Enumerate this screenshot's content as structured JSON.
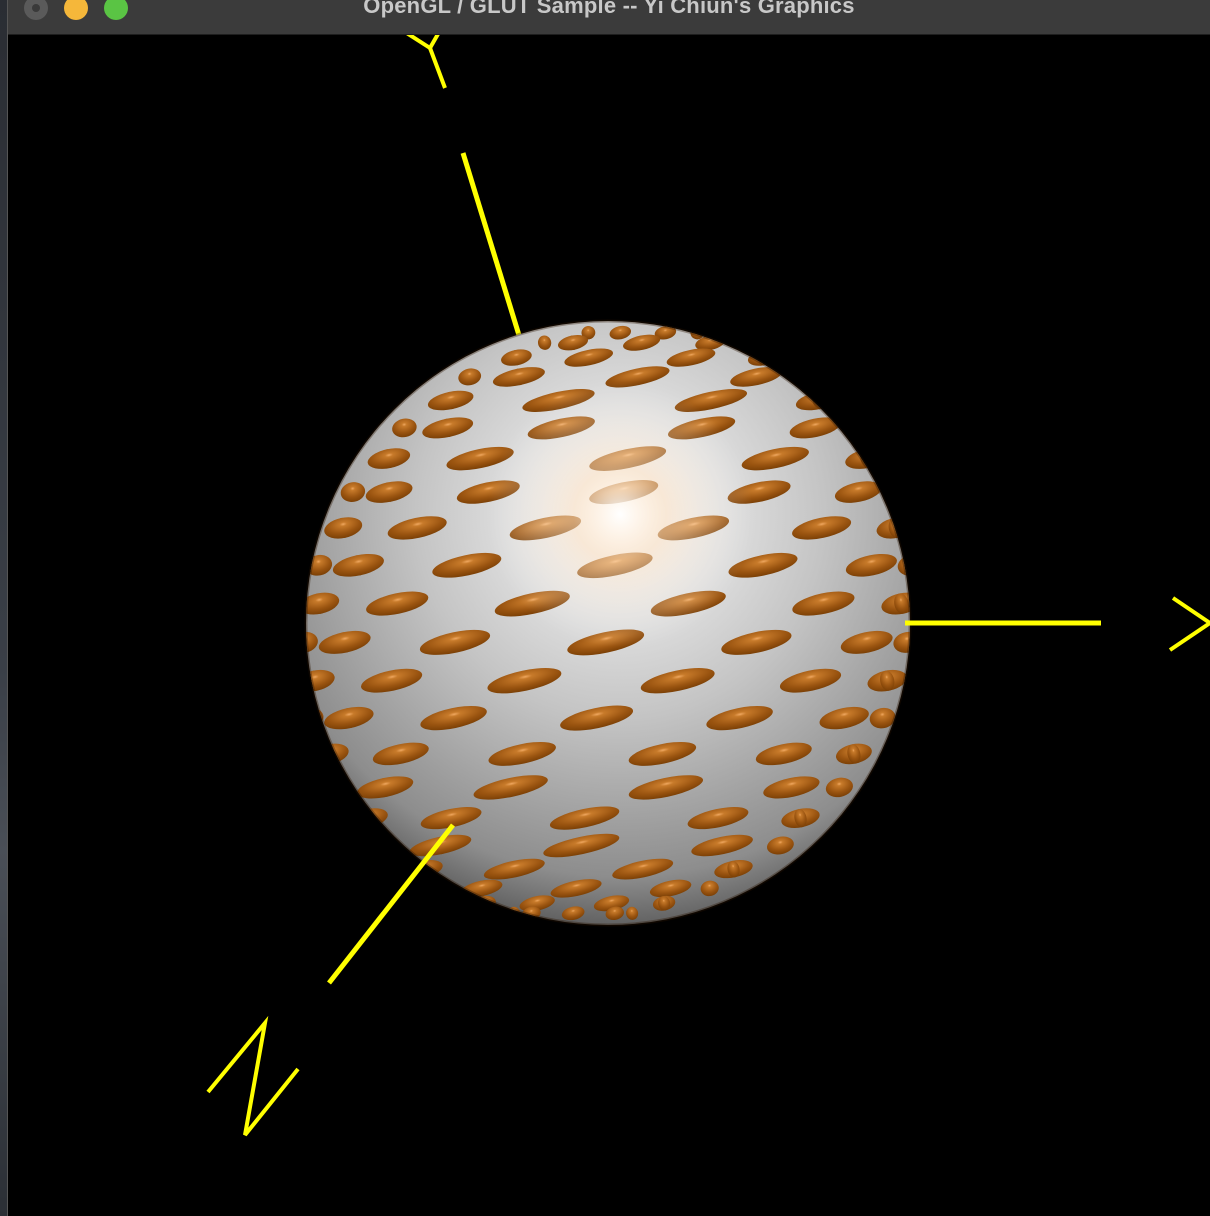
{
  "window": {
    "title": "OpenGL / GLUT Sample -- Yi Chiun's Graphics",
    "controls": [
      "close-button",
      "minimize-button",
      "zoom-button"
    ]
  },
  "scene": {
    "background_color": "#000000",
    "axis_color": "#ffff00",
    "axes": [
      {
        "name": "x-axis",
        "label": "X"
      },
      {
        "name": "y-axis",
        "label": "Y"
      },
      {
        "name": "z-axis",
        "label": "Z"
      }
    ],
    "sphere": {
      "base_color": "#c8c8c8",
      "pattern_color": "#8a4a08",
      "highlight_color": "#ffffff",
      "pattern": "elliptical-spots"
    }
  }
}
